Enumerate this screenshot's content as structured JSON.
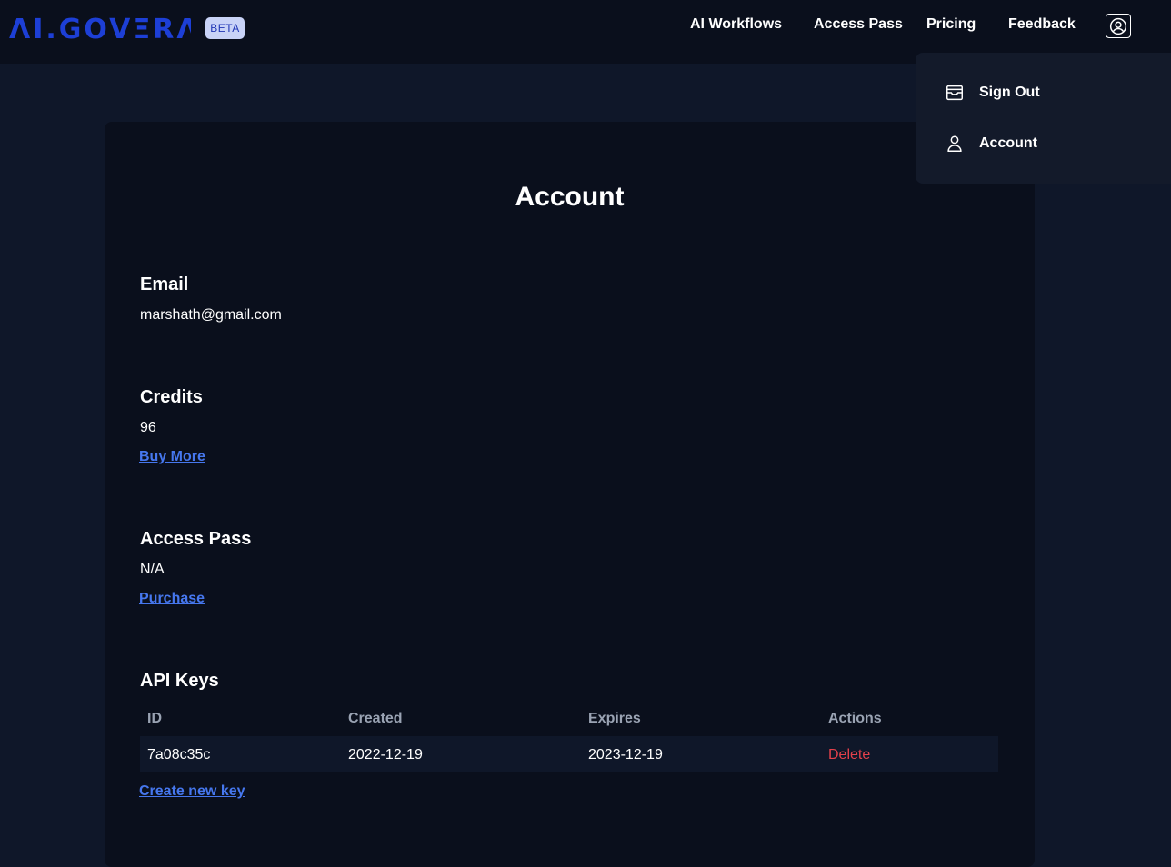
{
  "header": {
    "logo_text": "AI GOVERA",
    "badge": "BETA",
    "nav": [
      "AI Workflows",
      "Access Pass",
      "Pricing",
      "Feedback"
    ]
  },
  "dropdown": {
    "items": [
      {
        "label": "Sign Out",
        "icon": "archive-box-icon"
      },
      {
        "label": "Account",
        "icon": "user-icon"
      }
    ]
  },
  "account": {
    "title": "Account",
    "email": {
      "heading": "Email",
      "value": "marshath@gmail.com"
    },
    "credits": {
      "heading": "Credits",
      "value": "96",
      "link": "Buy More"
    },
    "access_pass": {
      "heading": "Access Pass",
      "value": "N/A",
      "link": "Purchase"
    },
    "api_keys": {
      "heading": "API Keys",
      "columns": [
        "ID",
        "Created",
        "Expires",
        "Actions"
      ],
      "rows": [
        {
          "id": "7a08c35c",
          "created": "2022-12-19",
          "expires": "2023-12-19",
          "action": "Delete"
        }
      ],
      "create_link": "Create new key"
    }
  },
  "colors": {
    "brand": "#1d3fd6",
    "link": "#4677ee",
    "danger": "#e5414b",
    "background": "#0f1729",
    "surface": "#0a0f1c"
  }
}
